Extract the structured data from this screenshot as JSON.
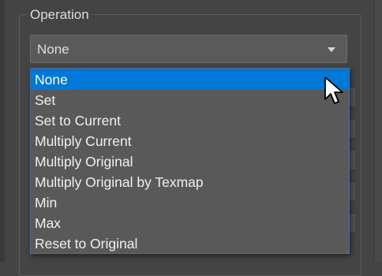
{
  "group": {
    "title": "Operation"
  },
  "select": {
    "value": "None",
    "arrow_icon": "chevron-down-icon"
  },
  "dropdown": {
    "options": [
      {
        "label": "None",
        "selected": true
      },
      {
        "label": "Set",
        "selected": false
      },
      {
        "label": "Set to Current",
        "selected": false
      },
      {
        "label": "Multiply Current",
        "selected": false
      },
      {
        "label": "Multiply Original",
        "selected": false
      },
      {
        "label": "Multiply Original by Texmap",
        "selected": false
      },
      {
        "label": "Min",
        "selected": false
      },
      {
        "label": "Max",
        "selected": false
      },
      {
        "label": "Reset to Original",
        "selected": false
      }
    ]
  },
  "colors": {
    "panel_bg": "#444444",
    "dropdown_bg": "#595959",
    "highlight": "#0078d7",
    "accent_border": "#2f74c4"
  },
  "cursor": {
    "icon": "mouse-pointer-icon"
  }
}
